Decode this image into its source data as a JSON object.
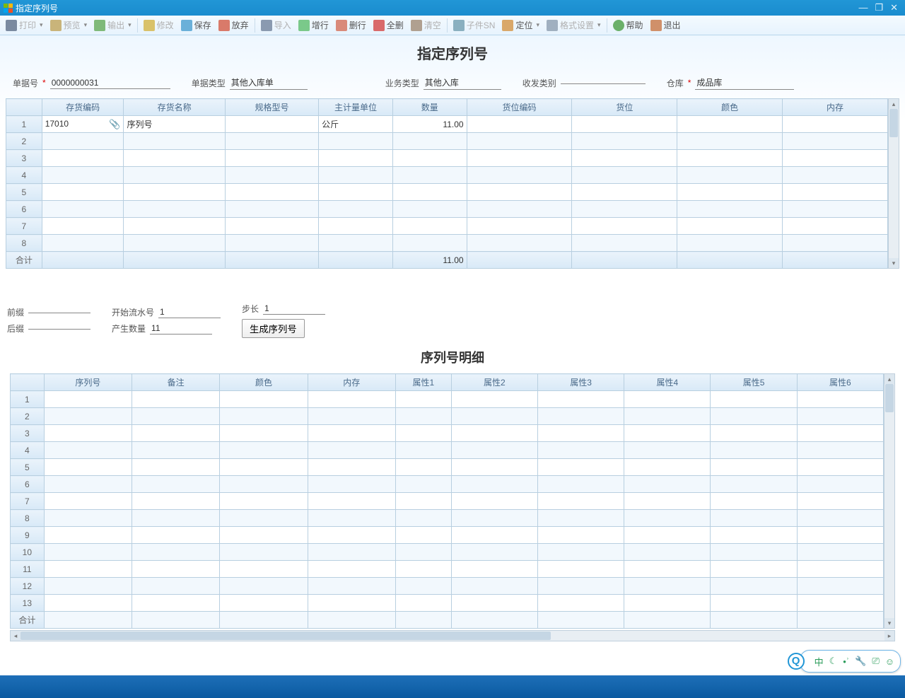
{
  "window": {
    "title": "指定序列号"
  },
  "toolbar": {
    "print": "打印",
    "preview": "预览",
    "export": "输出",
    "edit": "修改",
    "save": "保存",
    "discard": "放弃",
    "import": "导入",
    "addrow": "增行",
    "delrow": "删行",
    "delall": "全删",
    "clear": "清空",
    "sn": "子件SN",
    "locate": "定位",
    "format": "格式设置",
    "help": "帮助",
    "exit": "退出"
  },
  "pageTitle": "指定序列号",
  "header": {
    "docNo": {
      "label": "单据号",
      "value": "0000000031"
    },
    "docType": {
      "label": "单据类型",
      "value": "其他入库单"
    },
    "bizType": {
      "label": "业务类型",
      "value": "其他入库"
    },
    "ioType": {
      "label": "收发类别",
      "value": ""
    },
    "warehouse": {
      "label": "仓库",
      "value": "成品库"
    }
  },
  "grid1": {
    "cols": [
      "存货编码",
      "存货名称",
      "规格型号",
      "主计量单位",
      "数量",
      "货位编码",
      "货位",
      "颜色",
      "内存"
    ],
    "rows": [
      {
        "code": "17010",
        "name": "序列号",
        "spec": "",
        "unit": "公斤",
        "qty": "11.00",
        "binCode": "",
        "bin": "",
        "color": "",
        "mem": ""
      }
    ],
    "totalLabel": "合计",
    "totalQty": "11.00",
    "emptyRows": 7
  },
  "gen": {
    "prefix": {
      "label": "前缀",
      "value": ""
    },
    "suffix": {
      "label": "后缀",
      "value": ""
    },
    "startNo": {
      "label": "开始流水号",
      "value": "1"
    },
    "step": {
      "label": "步长",
      "value": "1"
    },
    "count": {
      "label": "产生数量",
      "value": "11"
    },
    "button": "生成序列号"
  },
  "section2Title": "序列号明细",
  "grid2": {
    "cols": [
      "序列号",
      "备注",
      "颜色",
      "内存",
      "属性1",
      "属性2",
      "属性3",
      "属性4",
      "属性5",
      "属性6"
    ],
    "rowCount": 13,
    "totalLabel": "合计"
  },
  "tray": {
    "ime": "中"
  }
}
